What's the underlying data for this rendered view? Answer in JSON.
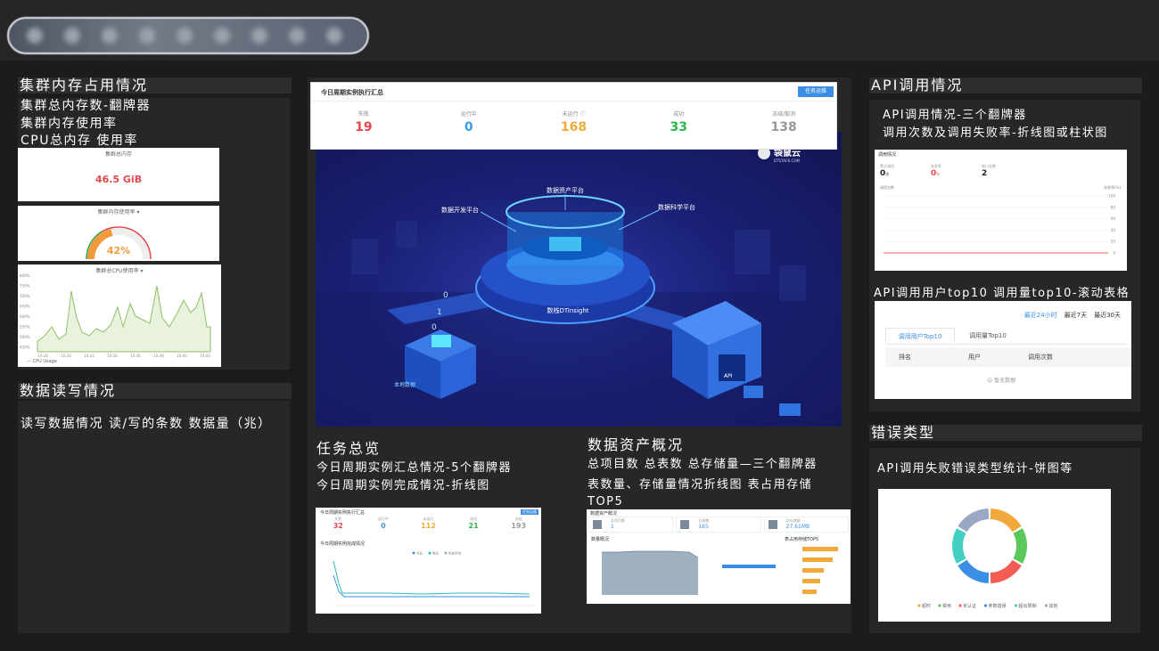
{
  "left": {
    "title": "集群内存占用情况",
    "notes": [
      "集群总内存数-翻牌器",
      "集群内存使用率",
      "CPU总内存 使用率"
    ],
    "card1": {
      "title": "集群总内存",
      "value": "46.5 GiB"
    },
    "card2": {
      "title": "集群内存使用率",
      "value": "42%",
      "fraction": 0.42
    },
    "card3": {
      "title": "集群总CPU使用率",
      "y_ticks": [
        "800%",
        "750%",
        "700%",
        "650%",
        "600%",
        "550%",
        "500%",
        "450%"
      ],
      "x_ticks": [
        "10:28",
        "10:30",
        "10:32",
        "10:34",
        "10:36",
        "10:38",
        "10:40",
        "10:42"
      ],
      "legend": "— CPU Usage"
    },
    "rw_title": "数据读写情况",
    "rw_note": "读写数据情况 读/写的条数 数据量（兆）"
  },
  "middle": {
    "summary": {
      "title": "今日周期实例执行汇总",
      "button": "任务运维",
      "stats": [
        {
          "label": "失败",
          "value": "19",
          "color": "#e5484d"
        },
        {
          "label": "运行中",
          "value": "0",
          "color": "#3a9ce6"
        },
        {
          "label": "未运行 ⓘ",
          "value": "168",
          "color": "#f2a93b"
        },
        {
          "label": "成功",
          "value": "33",
          "color": "#2db44b"
        },
        {
          "label": "冻结/取消",
          "value": "138",
          "color": "#999999"
        }
      ]
    },
    "illus": {
      "logo": "袋鼠云",
      "logo_sub": "DTSTACK.COM",
      "labels": {
        "assets": "数据资产平台",
        "dev": "数据开发平台",
        "science": "数据科学平台",
        "insight": "数栈DTinsight",
        "local": "本地数据",
        "api": "API"
      },
      "digits": [
        "0",
        "1",
        "0"
      ]
    },
    "task": {
      "title": "任务总览",
      "notes": [
        "今日周期实例汇总情况-5个翻牌器",
        "今日周期实例完成情况-折线图"
      ],
      "mini_title": "今日周期实例执行汇总",
      "mini_button": "任务运维",
      "mini_stats": [
        {
          "label": "失败",
          "value": "32",
          "color": "#e5484d"
        },
        {
          "label": "运行中",
          "value": "0",
          "color": "#3a9ce6"
        },
        {
          "label": "未运行",
          "value": "112",
          "color": "#f2a93b"
        },
        {
          "label": "成功",
          "value": "21",
          "color": "#2db44b"
        },
        {
          "label": "冻结",
          "value": "193",
          "color": "#999999"
        }
      ],
      "chart_title": "今日周期实例完成情况",
      "legend": [
        "今日",
        "昨日",
        "历史平均"
      ]
    },
    "assets": {
      "title": "数据资产概况",
      "notes": [
        "总项目数 总表数 总存储量—三个翻牌器",
        "表数量、存储量情况折线图 表占用存储",
        "TOP5"
      ],
      "mini_title": "数据资产概况",
      "boxes": [
        {
          "label": "总项目数",
          "value": "1"
        },
        {
          "label": "总表数",
          "value": "165"
        },
        {
          "label": "总存储量",
          "value": "27.61MB"
        }
      ],
      "chart_title": "数量概况",
      "right_title": "表占用存储TOP5"
    }
  },
  "right": {
    "api_title": "API调用情况",
    "api_notes": [
      "API调用情况-三个翻牌器",
      "调用次数及调用失败率-折线图或柱状图"
    ],
    "api_card": {
      "header": "调用情况",
      "stats": [
        {
          "label": "累计调用",
          "value": "0",
          "unit": "次",
          "color": "#222222"
        },
        {
          "label": "失败率",
          "value": "0",
          "unit": "%",
          "color": "#e5484d"
        },
        {
          "label": "接口总数",
          "value": "2",
          "unit": "",
          "color": "#222222"
        }
      ],
      "left_axis": "调用次数",
      "right_axis": "失败率(%)",
      "y_ticks": [
        "100",
        "80",
        "60",
        "40",
        "20",
        "0"
      ]
    },
    "top_title": "API调用用户top10 调用量top10-滚动表格",
    "top_card": {
      "ranges": [
        "最近24小时",
        "最近7天",
        "最近30天"
      ],
      "tabs": [
        "调用用户Top10",
        "调用量Top10"
      ],
      "columns": [
        "排名",
        "用户",
        "调用次数"
      ],
      "empty": "☹ 暂无数据"
    },
    "err_title": "错误类型",
    "err_note": "API调用失败错误类型统计-饼图等",
    "pie_legend": [
      {
        "label": "超时",
        "color": "#f2a93b"
      },
      {
        "label": "禁用",
        "color": "#5ac85a"
      },
      {
        "label": "未认证",
        "color": "#f25c54"
      },
      {
        "label": "参数错误",
        "color": "#3a8ee6"
      },
      {
        "label": "超出限制",
        "color": "#45d1c2"
      },
      {
        "label": "其他",
        "color": "#9aa8c4"
      }
    ]
  },
  "colors": {
    "accent": "#3a8ee6",
    "panel": "#272727",
    "bg": "#1c1c1c"
  }
}
